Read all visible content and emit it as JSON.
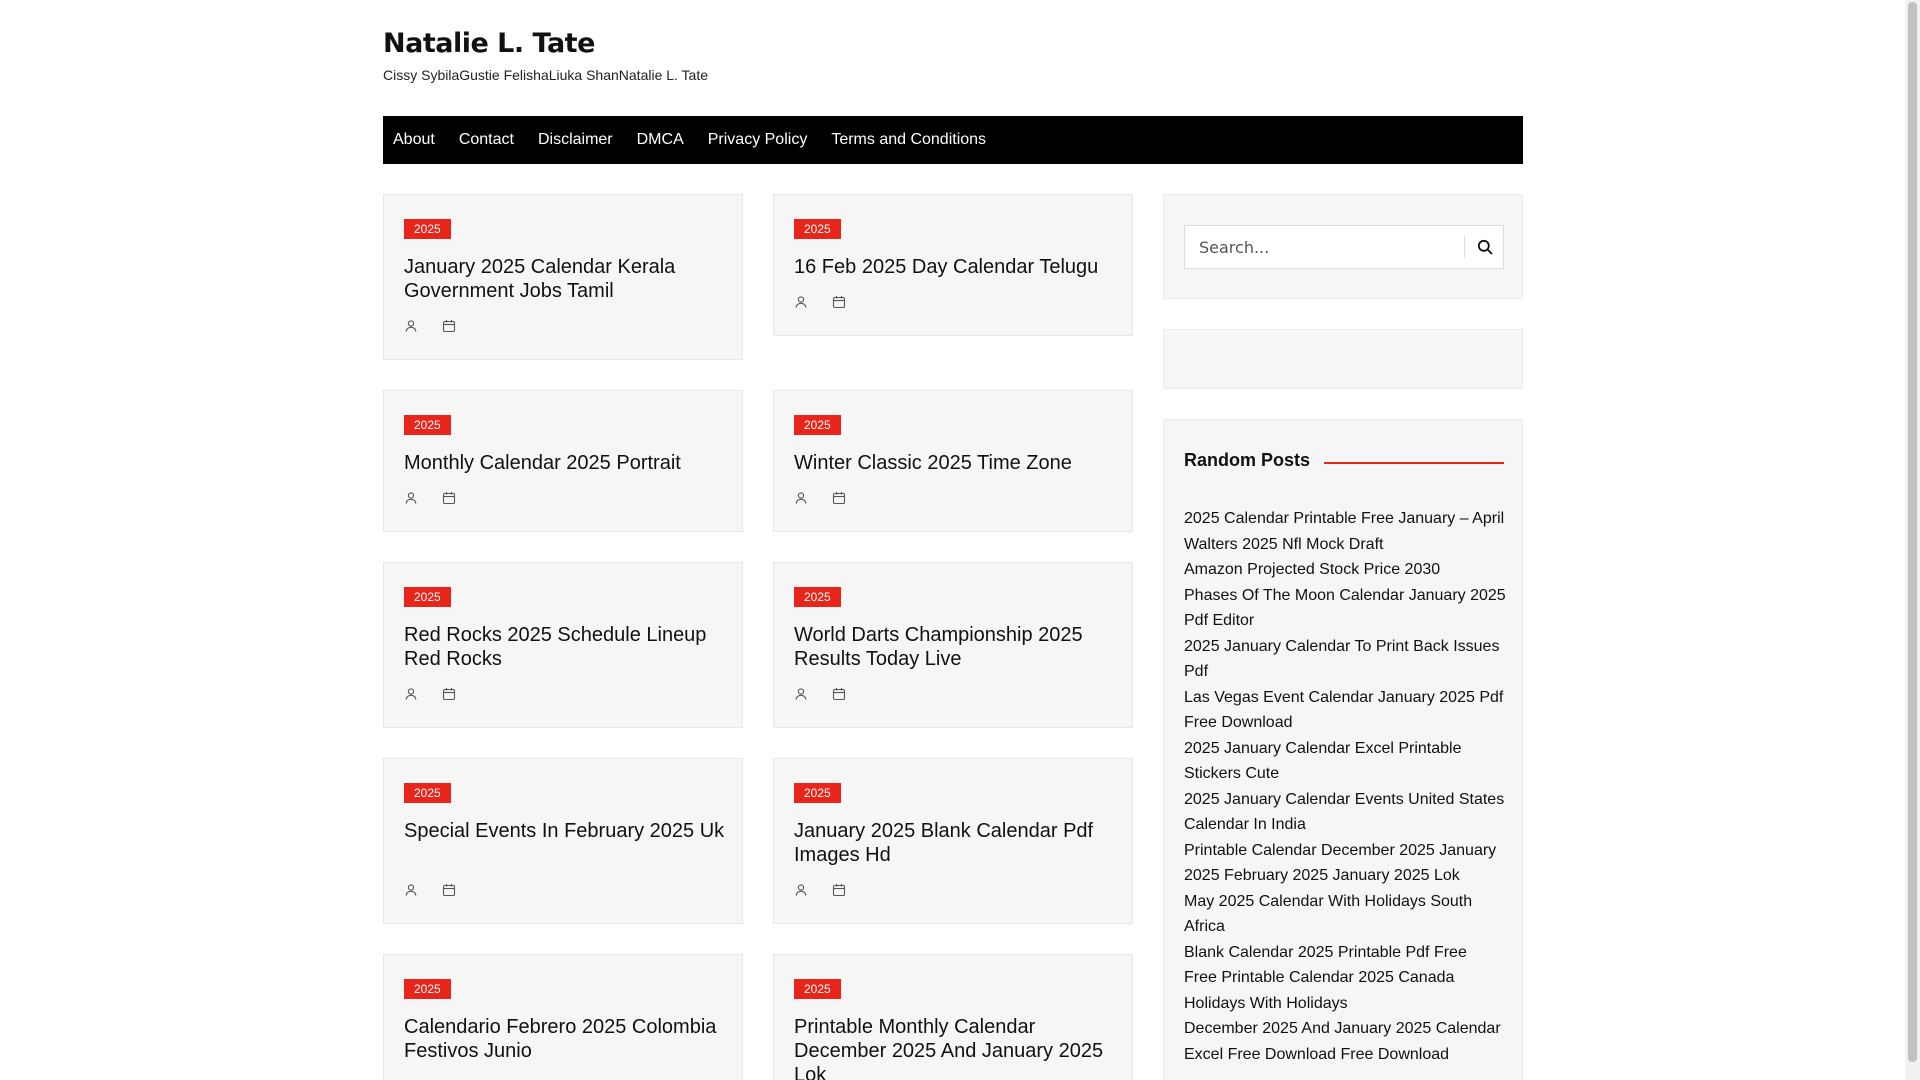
{
  "site": {
    "title": "Natalie L. Tate",
    "description": "Cissy SybilaGustie FelishaLiuka ShanNatalie L. Tate"
  },
  "nav": [
    "About",
    "Contact",
    "Disclaimer",
    "DMCA",
    "Privacy Policy",
    "Terms and Conditions"
  ],
  "posts": [
    {
      "category": "2025",
      "title": "January 2025 Calendar Kerala Government Jobs Tamil"
    },
    {
      "category": "2025",
      "title": "16 Feb 2025 Day Calendar Telugu"
    },
    {
      "category": "2025",
      "title": "Monthly Calendar 2025 Portrait"
    },
    {
      "category": "2025",
      "title": "Winter Classic 2025 Time Zone"
    },
    {
      "category": "2025",
      "title": "Red Rocks 2025 Schedule Lineup Red Rocks"
    },
    {
      "category": "2025",
      "title": "World Darts Championship 2025 Results Today Live"
    },
    {
      "category": "2025",
      "title": "Special Events In February 2025 Uk"
    },
    {
      "category": "2025",
      "title": "January 2025 Blank Calendar Pdf Images Hd"
    },
    {
      "category": "2025",
      "title": "Calendario Febrero 2025 Colombia Festivos Junio"
    },
    {
      "category": "2025",
      "title": "Printable Monthly Calendar December 2025 And January 2025 Lok"
    }
  ],
  "sidebar": {
    "search_placeholder": "Search...",
    "random_title": "Random Posts",
    "random_posts": [
      "2025 Calendar Printable Free January – April",
      "Walters 2025 Nfl Mock Draft",
      "Amazon Projected Stock Price 2030",
      "Phases Of The Moon Calendar January 2025 Pdf Editor",
      "2025 January Calendar To Print Back Issues Pdf",
      "Las Vegas Event Calendar January 2025 Pdf Free Download",
      "2025 January Calendar Excel Printable Stickers Cute",
      "2025 January Calendar Events United States Calendar In India",
      "Printable Calendar December 2025 January 2025 February 2025 January 2025 Lok",
      "May 2025 Calendar With Holidays South Africa",
      "Blank Calendar 2025 Printable Pdf Free",
      "Free Printable Calendar 2025 Canada Holidays With Holidays",
      "December 2025 And January 2025 Calendar Excel Free Download Free Download"
    ]
  },
  "colors": {
    "accent": "#e8251b",
    "nav_bg": "#000000",
    "card_bg": "#f6f6f6"
  },
  "icons": {
    "meta": [
      "user-icon",
      "calendar-icon"
    ],
    "search": "search-icon"
  }
}
